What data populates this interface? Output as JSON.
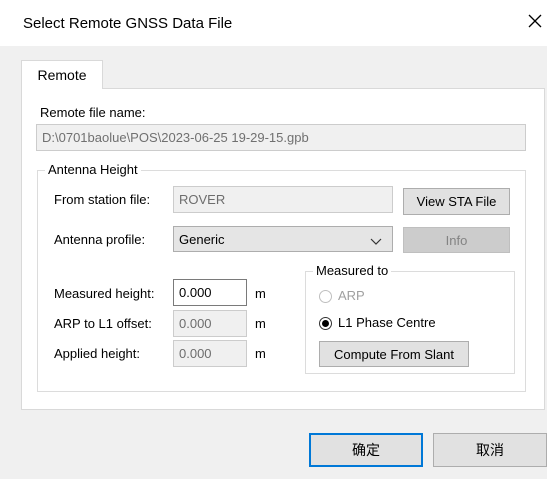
{
  "window": {
    "title": "Select Remote GNSS Data File"
  },
  "tabs": [
    {
      "label": "Remote"
    }
  ],
  "remote": {
    "file_label": "Remote file name:",
    "file_value": "D:\\0701baolue\\POS\\2023-06-25 19-29-15.gpb",
    "antenna": {
      "group_title": "Antenna Height",
      "station_label": "From station file:",
      "station_value": "ROVER",
      "view_sta_button": "View STA File",
      "profile_label": "Antenna profile:",
      "profile_value": "Generic",
      "info_button": "Info",
      "measured_height_label": "Measured height:",
      "measured_height_value": "0.000",
      "arp_offset_label": "ARP to L1 offset:",
      "arp_offset_value": "0.000",
      "applied_height_label": "Applied height:",
      "applied_height_value": "0.000",
      "unit": "m",
      "measured_to": {
        "title": "Measured to",
        "arp_label": "ARP",
        "l1_label": "L1 Phase Centre",
        "selected": "L1 Phase Centre",
        "compute_button": "Compute From Slant"
      }
    }
  },
  "footer": {
    "ok_button": "确定",
    "cancel_button": "取消"
  },
  "icons": {
    "close": "close-icon",
    "dropdown": "chevron-down-icon"
  },
  "colors": {
    "accent": "#0078d7",
    "window_bg": "#f0f0f0",
    "panel_bg": "#ffffff"
  }
}
